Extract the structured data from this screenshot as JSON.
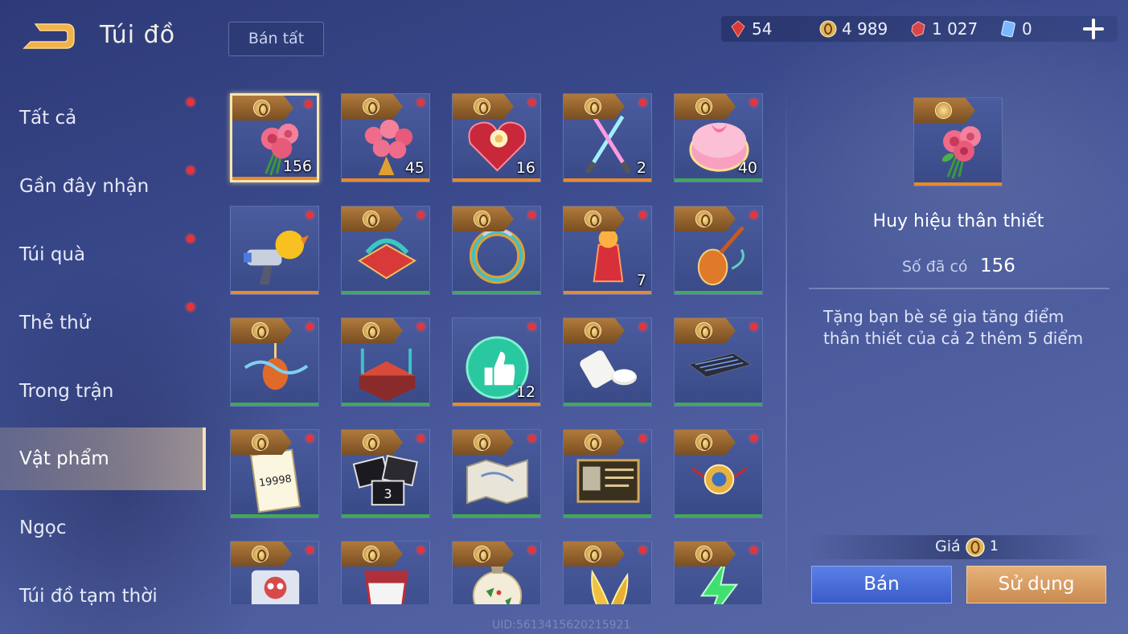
{
  "header": {
    "title": "Túi đồ",
    "sell_all_label": "Bán tất",
    "currencies": [
      {
        "icon": "red-gem-icon",
        "value": "54"
      },
      {
        "icon": "gold-coin-icon",
        "value": "4 989"
      },
      {
        "icon": "ruby-icon",
        "value": "1 027"
      },
      {
        "icon": "blue-card-icon",
        "value": "0"
      }
    ]
  },
  "sidebar": {
    "items": [
      {
        "label": "Tất cả",
        "dot": true
      },
      {
        "label": "Gần đây nhận",
        "dot": true
      },
      {
        "label": "Túi quà",
        "dot": true
      },
      {
        "label": "Thẻ thử",
        "dot": true
      },
      {
        "label": "Trong trận",
        "dot": false
      },
      {
        "label": "Vật phẩm",
        "dot": false,
        "active": true
      },
      {
        "label": "Ngọc",
        "dot": false
      },
      {
        "label": "Túi đồ tạm thời",
        "dot": false
      }
    ]
  },
  "grid": {
    "items": [
      {
        "icon": "rose-bouquet-icon",
        "qty": "156",
        "bar": "orange",
        "selected": true
      },
      {
        "icon": "large-rose-bouquet-icon",
        "qty": "45",
        "bar": "orange"
      },
      {
        "icon": "heart-chocolate-box-icon",
        "qty": "16",
        "bar": "orange"
      },
      {
        "icon": "light-sabers-icon",
        "qty": "2",
        "bar": "orange"
      },
      {
        "icon": "pink-cake-icon",
        "qty": "40",
        "bar": "green"
      },
      {
        "icon": "duck-blaster-icon",
        "qty": "",
        "bar": "orange"
      },
      {
        "icon": "gift-wrap-icon",
        "qty": "",
        "bar": "green"
      },
      {
        "icon": "golden-ring-icon",
        "qty": "",
        "bar": "green"
      },
      {
        "icon": "red-potion-icon",
        "qty": "7",
        "bar": "orange"
      },
      {
        "icon": "pipa-instrument-icon",
        "qty": "",
        "bar": "green"
      },
      {
        "icon": "ribbon-lantern-icon",
        "qty": "",
        "bar": "green"
      },
      {
        "icon": "stage-platform-icon",
        "qty": "",
        "bar": "green"
      },
      {
        "icon": "thumbs-up-badge-icon",
        "qty": "12",
        "bar": "orange"
      },
      {
        "icon": "pill-bottle-icon",
        "qty": "",
        "bar": "green"
      },
      {
        "icon": "keyboard-icon",
        "qty": "",
        "bar": "green"
      },
      {
        "icon": "note-card-icon",
        "qty": "",
        "bar": "green",
        "card_text": "19998"
      },
      {
        "icon": "photo-cards-icon",
        "qty": "",
        "bar": "green"
      },
      {
        "icon": "treasure-map-icon",
        "qty": "",
        "bar": "green"
      },
      {
        "icon": "id-card-icon",
        "qty": "",
        "bar": "green"
      },
      {
        "icon": "medallion-icon",
        "qty": "",
        "bar": "green"
      },
      {
        "icon": "pet-bag-icon",
        "qty": "",
        "bar": "green"
      },
      {
        "icon": "paper-cup-icon",
        "qty": "",
        "bar": "green"
      },
      {
        "icon": "christmas-ornament-icon",
        "qty": "",
        "bar": "green"
      },
      {
        "icon": "golden-wings-icon",
        "qty": "",
        "bar": "green"
      },
      {
        "icon": "lightning-icon",
        "qty": "",
        "bar": "green"
      }
    ]
  },
  "detail": {
    "name": "Huy hiệu thân thiết",
    "owned_label": "Số đã có",
    "owned_value": "156",
    "description": "Tặng bạn bè sẽ gia tăng điểm thân thiết của cả 2 thêm 5 điểm",
    "price_label": "Giá",
    "price_value": "1",
    "sell_label": "Bán",
    "use_label": "Sử dụng"
  },
  "footer": {
    "uid": "UID:5613415620215921"
  }
}
